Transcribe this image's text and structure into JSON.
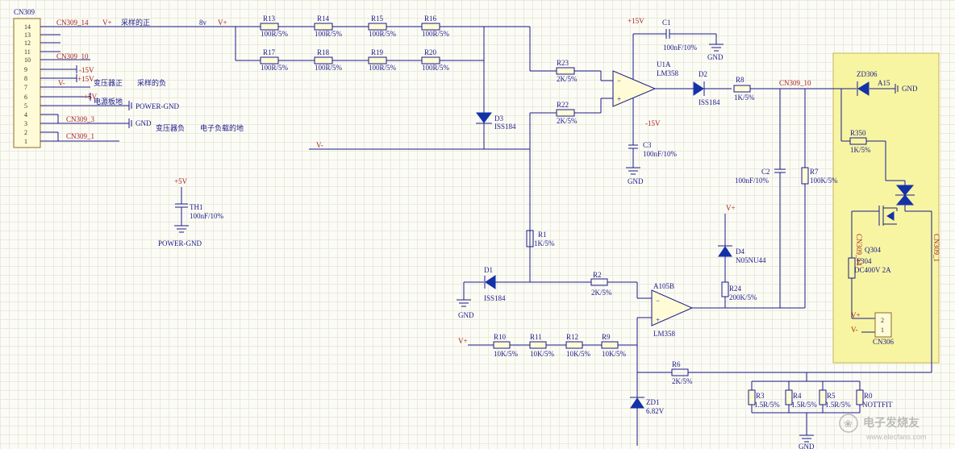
{
  "connector": {
    "ref": "CN309",
    "pins": [
      "14",
      "13",
      "12",
      "11",
      "10",
      "9",
      "8",
      "7",
      "6",
      "5",
      "4",
      "3",
      "2",
      "1"
    ]
  },
  "nets": {
    "cn309_14": "CN309_14",
    "cn309_10": "CN309_10",
    "cn309_3": "CN309_3",
    "cn309_1": "CN309_1",
    "vplus": "V+",
    "vminus": "V-",
    "pos15v": "+15V",
    "neg15v": "-15V",
    "pos5v": "+5V",
    "gnd": "GND",
    "power_gnd": "POWER-GND"
  },
  "labels": {
    "v8": "8v"
  },
  "notes": {
    "sample_positive": "采样的正",
    "transformer_positive": "变压器正",
    "sample_negative": "采样的负",
    "power_board": "电源板地",
    "transformer_negative": "变压器负",
    "load_ground": "电子负载的地"
  },
  "resistor_rows": {
    "top": [
      {
        "ref": "R13",
        "value": "100R/5%"
      },
      {
        "ref": "R14",
        "value": "100R/5%"
      },
      {
        "ref": "R15",
        "value": "100R/5%"
      },
      {
        "ref": "R16",
        "value": "100R/5%"
      }
    ],
    "second": [
      {
        "ref": "R17",
        "value": "100R/5%"
      },
      {
        "ref": "R18",
        "value": "100R/5%"
      },
      {
        "ref": "R19",
        "value": "100R/5%"
      },
      {
        "ref": "R20",
        "value": "100R/5%"
      }
    ],
    "feedback": [
      {
        "ref": "R23",
        "value": "2K/5%"
      },
      {
        "ref": "R22",
        "value": "2K/5%"
      }
    ],
    "bottom": [
      {
        "ref": "R10",
        "value": "10K/5%"
      },
      {
        "ref": "R11",
        "value": "10K/5%"
      },
      {
        "ref": "R12",
        "value": "10K/5%"
      },
      {
        "ref": "R9",
        "value": "10K/5%"
      }
    ],
    "shunt": [
      {
        "ref": "R3",
        "value": "1.5R/5%"
      },
      {
        "ref": "R4",
        "value": "1.5R/5%"
      },
      {
        "ref": "R5",
        "value": "1.5R/5%"
      },
      {
        "ref": "R0",
        "value": "NOTTFIT"
      }
    ]
  },
  "parts": {
    "th1": {
      "ref": "TH1",
      "value": "100nF/10%",
      "supply": "+5V",
      "gnd": "POWER-GND"
    },
    "d3": {
      "ref": "D3",
      "value": "ISS184"
    },
    "u1a": {
      "ref": "U1A",
      "value": "LM358"
    },
    "c1": {
      "ref": "C1",
      "value": "100nF/10%"
    },
    "c3": {
      "ref": "C3",
      "value": "100nF/10%"
    },
    "d2": {
      "ref": "D2",
      "value": "ISS184"
    },
    "r8": {
      "ref": "R8",
      "value": "1K/5%"
    },
    "c2": {
      "ref": "C2",
      "value": "100nF/10%"
    },
    "r7": {
      "ref": "R7",
      "value": "100K/5%"
    },
    "d4": {
      "ref": "D4",
      "value": "N05NU44"
    },
    "r24": {
      "ref": "R24",
      "value": "200K/5%"
    },
    "r1": {
      "ref": "R1",
      "value": "1K/5%"
    },
    "d1": {
      "ref": "D1",
      "value": "ISS184"
    },
    "r2": {
      "ref": "R2",
      "value": "2K/5%"
    },
    "a105b": {
      "ref": "A105B",
      "value": "LM358"
    },
    "r6": {
      "ref": "R6",
      "value": "2K/5%"
    },
    "zd1": {
      "ref": "ZD1",
      "value": "6.82V"
    },
    "zd306": {
      "ref": "ZD306"
    },
    "a15": {
      "ref": "A15"
    },
    "r350": {
      "ref": "R350",
      "value": "1K/5%"
    },
    "q304": {
      "ref": "Q304"
    },
    "f304": {
      "ref": "F304",
      "value": "DC400V 2A"
    },
    "cn306": {
      "ref": "CN306"
    }
  }
}
